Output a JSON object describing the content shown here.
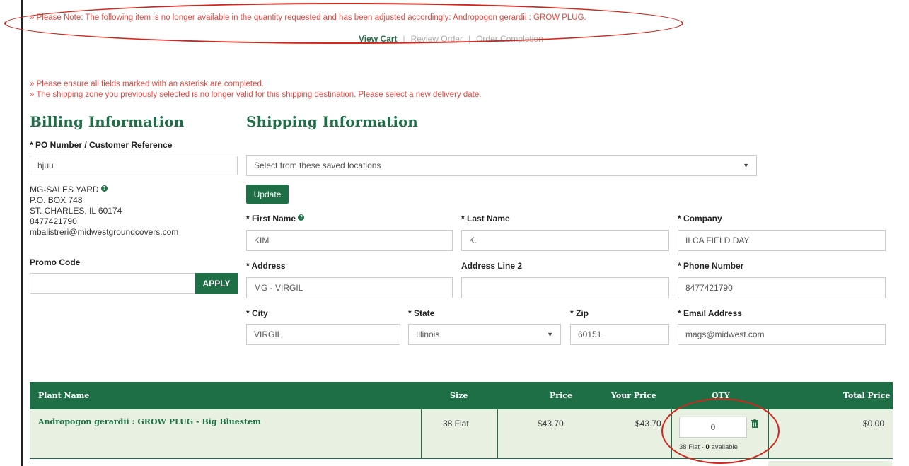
{
  "notice_top": "» Please Note: The following item is no longer available in the quantity requested and has been adjusted accordingly: Andropogon gerardii : GROW PLUG.",
  "steps": {
    "view_cart": "View Cart",
    "review_order": "Review Order",
    "order_completion": "Order Completion",
    "separator": "|"
  },
  "alerts": [
    "» Please ensure all fields marked with an asterisk are completed.",
    "» The shipping zone you previously selected is no longer valid for this shipping destination. Please select a new delivery date."
  ],
  "billing": {
    "title": "Billing Information",
    "po_label": "* PO Number / Customer Reference",
    "po_value": "hjuu",
    "address_lines": [
      "MG-SALES YARD",
      "P.O. BOX 748",
      "ST. CHARLES, IL 60174",
      "8477421790",
      "mbalistreri@midwestgroundcovers.com"
    ],
    "promo_label": "Promo Code",
    "promo_value": "",
    "apply_label": "APPLY"
  },
  "shipping": {
    "title": "Shipping Information",
    "saved_locations": "Select from these saved locations",
    "update_label": "Update",
    "first_name_label": "* First Name",
    "first_name": "KIM",
    "last_name_label": "* Last Name",
    "last_name": "K.",
    "company_label": "* Company",
    "company": "ILCA FIELD DAY",
    "address_label": "* Address",
    "address": "MG - VIRGIL",
    "address2_label": "Address Line 2",
    "address2": "",
    "phone_label": "* Phone Number",
    "phone": "8477421790",
    "city_label": "* City",
    "city": "VIRGIL",
    "state_label": "* State",
    "state": "Illinois",
    "zip_label": "* Zip",
    "zip": "60151",
    "email_label": "* Email Address",
    "email": "mags@midwest.com"
  },
  "icons": {
    "help": "?",
    "dropdown": "▼"
  },
  "table": {
    "headers": {
      "plant": "Plant Name",
      "size": "Size",
      "price": "Price",
      "your_price": "Your Price",
      "qty": "QTY",
      "total": "Total Price"
    },
    "row": {
      "plant": "Andropogon gerardii : GROW PLUG - Big Bluestem",
      "size": "38 Flat",
      "price": "$43.70",
      "your_price": "$43.70",
      "qty": "0",
      "avail_prefix": "38 Flat - ",
      "avail_count": "0",
      "avail_suffix": " available",
      "total": "$0.00"
    }
  },
  "colors": {
    "brand_green": "#1f6f46",
    "alert_red": "#e8473f",
    "annotation_red": "#d0261c",
    "row_bg": "#e8f1e1"
  }
}
